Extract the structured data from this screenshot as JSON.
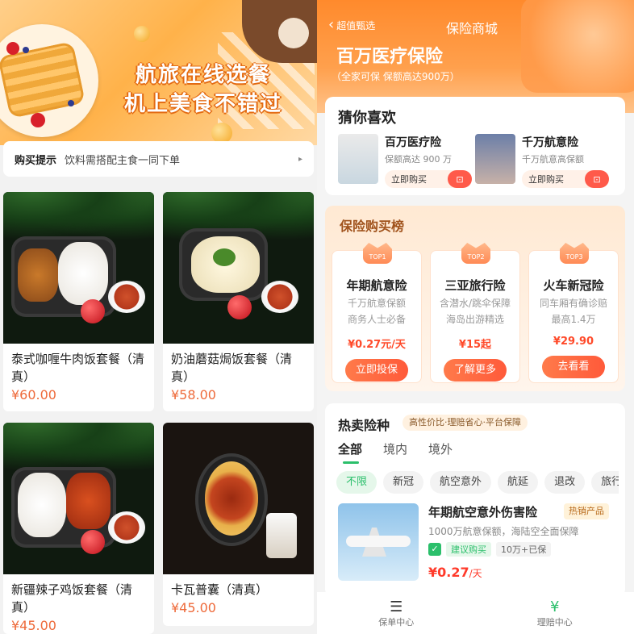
{
  "left": {
    "banner": {
      "line1": "航旅在线选餐",
      "line2": "机上美食不错过"
    },
    "tip": {
      "label": "购买提示",
      "text": "饮料需搭配主食一同下单",
      "arrow": "▸"
    },
    "meals": [
      {
        "name": "泰式咖喱牛肉饭套餐（清真）",
        "price": "¥60.00"
      },
      {
        "name": "奶油蘑菇焗饭套餐（清真）",
        "price": "¥58.00"
      },
      {
        "name": "新疆辣子鸡饭套餐（清真）",
        "price": "¥45.00"
      },
      {
        "name": "卡瓦普囊（清真）",
        "price": "¥45.00"
      }
    ]
  },
  "right": {
    "header": {
      "back_label": "超值甄选",
      "back_icon": "‹",
      "title": "保险商城",
      "hero_title": "百万医疗保险",
      "hero_subtitle": "（全家可保  保额高达900万）"
    },
    "guess": {
      "title": "猜你喜欢",
      "items": [
        {
          "name": "百万医疗险",
          "desc": "保额高达 900 万",
          "buy": "立即购买",
          "cart": "⊡"
        },
        {
          "name": "千万航意险",
          "desc": "千万航意高保额",
          "buy": "立即购买",
          "cart": "⊡"
        }
      ]
    },
    "ranking": {
      "title": "保险购买榜",
      "items": [
        {
          "badge": "TOP1",
          "name": "年期航意险",
          "line1": "千万航意保额",
          "line2": "商务人士必备",
          "price": "¥0.27元/天",
          "button": "立即投保"
        },
        {
          "badge": "TOP2",
          "name": "三亚旅行险",
          "line1": "含潜水/跳伞保障",
          "line2": "海岛出游精选",
          "price": "¥15起",
          "button": "了解更多"
        },
        {
          "badge": "TOP3",
          "name": "火车新冠险",
          "line1": "同车厢有确诊赔",
          "line2": "最高1.4万",
          "price": "¥29.90",
          "button": "去看看"
        }
      ]
    },
    "hot": {
      "title": "热卖险种",
      "badge": "高性价比·理赔省心·平台保障",
      "tabs": [
        "全部",
        "境内",
        "境外"
      ],
      "chips": [
        "不限",
        "新冠",
        "航空意外",
        "航延",
        "退改",
        "旅行"
      ],
      "product": {
        "name": "年期航空意外伤害险",
        "tag": "热销产品",
        "desc": "1000万航意保额，海陆空全面保障",
        "advice_icon": "✓",
        "advice": "建议购买",
        "count": "10万+已保",
        "price": "¥0.27",
        "unit": "/天"
      }
    },
    "nav": [
      {
        "icon": "☰",
        "label": "保单中心"
      },
      {
        "icon": "¥",
        "label": "理赔中心"
      }
    ]
  },
  "colors": {
    "accent": "#ff8a2c",
    "price": "#ff3a2a",
    "green": "#2bbf6b"
  }
}
